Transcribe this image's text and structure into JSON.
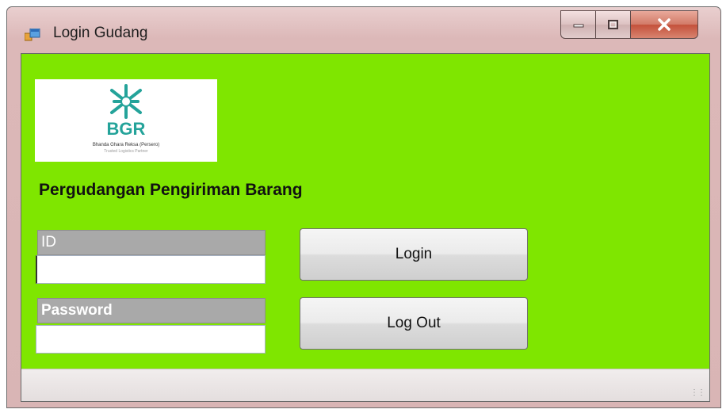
{
  "window": {
    "title": "Login Gudang",
    "icon": "form-app-icon",
    "controls": [
      "minimize-icon",
      "maximize-icon",
      "close-icon"
    ]
  },
  "colors": {
    "client_background": "#7FE600",
    "title_bar": "#DCB8B8",
    "close_button": "#C4503A",
    "logo_teal": "#24A39A"
  },
  "logo": {
    "text": "BGR",
    "subtitle": "Bhanda Ghara Reksa (Persero)",
    "tagline": "Trusted Logistics Partner"
  },
  "heading": "Pergudangan Pengiriman Barang",
  "form": {
    "id_label": "ID",
    "id_value": "",
    "password_label": "Password",
    "password_value": ""
  },
  "buttons": {
    "login": "Login",
    "logout": "Log Out"
  },
  "statusbar": {
    "grip_icon": "resize-grip-icon"
  }
}
